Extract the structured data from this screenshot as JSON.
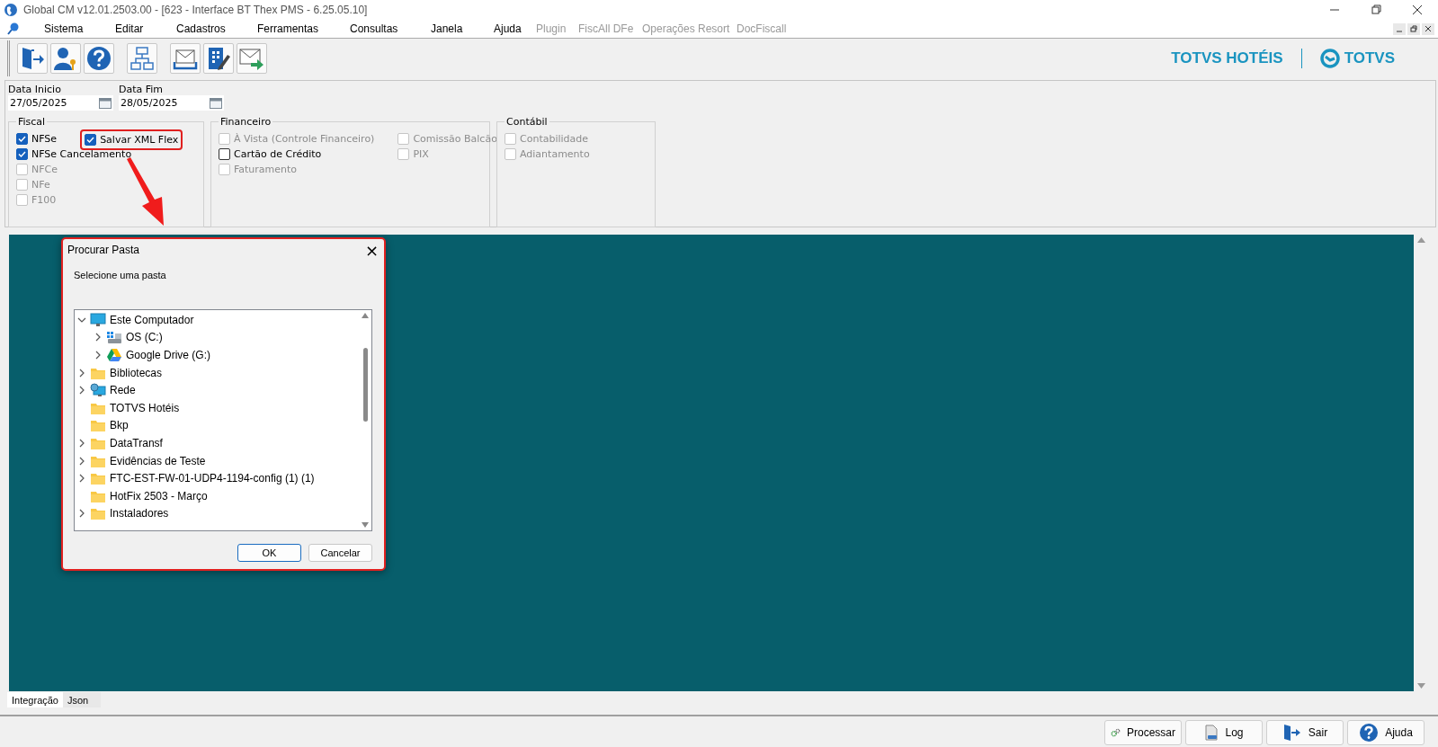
{
  "window": {
    "title": "Global CM v12.01.2503.00 - [623 - Interface BT Thex PMS - 6.25.05.10]"
  },
  "menu": [
    {
      "label": "Sistema",
      "disabled": false
    },
    {
      "label": "Editar",
      "disabled": false
    },
    {
      "label": "Cadastros",
      "disabled": false
    },
    {
      "label": "Ferramentas",
      "disabled": false
    },
    {
      "label": "Consultas",
      "disabled": false
    },
    {
      "label": "Janela",
      "disabled": false
    },
    {
      "label": "Ajuda",
      "disabled": false
    },
    {
      "label": "Plugin",
      "disabled": true
    },
    {
      "label": "FiscAll DFe",
      "disabled": true
    },
    {
      "label": "Operações Resort",
      "disabled": true
    },
    {
      "label": "DocFiscall",
      "disabled": true
    }
  ],
  "toolbar": [
    {
      "kind": "exit"
    },
    {
      "kind": "user"
    },
    {
      "kind": "help"
    },
    {
      "kind": "sep"
    },
    {
      "kind": "org"
    },
    {
      "kind": "sep"
    },
    {
      "kind": "mail"
    },
    {
      "kind": "grid"
    },
    {
      "kind": "send"
    }
  ],
  "brand": {
    "product": "TOTVS HOTÉIS",
    "logo": "TOTVS"
  },
  "dates": [
    {
      "label": "Data Inicio",
      "value": "27/05/2025"
    },
    {
      "label": "Data Fim",
      "value": "28/05/2025"
    }
  ],
  "groups": [
    {
      "title": "Fiscal",
      "columns": [
        [
          {
            "label": "NFSe",
            "checked": true,
            "disabled": false,
            "highlighted": false
          },
          {
            "label": "NFSe Cancelamento",
            "checked": true,
            "disabled": false,
            "highlighted": false
          },
          {
            "label": "NFCe",
            "checked": false,
            "disabled": true,
            "highlighted": false
          },
          {
            "label": "NFe",
            "checked": false,
            "disabled": true,
            "highlighted": false
          },
          {
            "label": "F100",
            "checked": false,
            "disabled": true,
            "highlighted": false
          }
        ],
        [
          {
            "label": "Salvar XML Flex",
            "checked": true,
            "disabled": false,
            "highlighted": true
          }
        ]
      ]
    },
    {
      "title": "Financeiro",
      "columns": [
        [
          {
            "label": "À Vista (Controle Financeiro)",
            "checked": false,
            "disabled": true,
            "highlighted": false
          },
          {
            "label": "Cartão de Crédito",
            "checked": false,
            "disabled": false,
            "highlighted": false
          },
          {
            "label": "Faturamento",
            "checked": false,
            "disabled": true,
            "highlighted": false
          }
        ],
        [
          {
            "label": "Comissão Balcão",
            "checked": false,
            "disabled": true,
            "highlighted": false
          },
          {
            "label": "PIX",
            "checked": false,
            "disabled": true,
            "highlighted": false
          }
        ]
      ]
    },
    {
      "title": "Contábil",
      "columns": [
        [
          {
            "label": "Contabilidade",
            "checked": false,
            "disabled": true,
            "highlighted": false
          },
          {
            "label": "Adiantamento",
            "checked": false,
            "disabled": true,
            "highlighted": false
          }
        ]
      ]
    }
  ],
  "dialog": {
    "title": "Procurar Pasta",
    "close": "×",
    "prompt": "Selecione uma pasta",
    "highlighted": true,
    "tree": [
      {
        "label": "Este Computador",
        "kind": "computer",
        "expandable": true,
        "expanded": true,
        "children": [
          {
            "label": "OS (C:)",
            "kind": "drive",
            "expandable": true,
            "expanded": false
          },
          {
            "label": "Google Drive (G:)",
            "kind": "cloud",
            "expandable": true,
            "expanded": false
          }
        ]
      },
      {
        "label": "Bibliotecas",
        "kind": "folder",
        "expandable": true,
        "expanded": false
      },
      {
        "label": "Rede",
        "kind": "network",
        "expandable": true,
        "expanded": false
      },
      {
        "label": "TOTVS Hotéis",
        "kind": "folder",
        "expandable": false
      },
      {
        "label": "Bkp",
        "kind": "folder",
        "expandable": false
      },
      {
        "label": "DataTransf",
        "kind": "folder",
        "expandable": true,
        "expanded": false
      },
      {
        "label": "Evidências de Teste",
        "kind": "folder",
        "expandable": true,
        "expanded": false
      },
      {
        "label": "FTC-EST-FW-01-UDP4-1194-config (1) (1)",
        "kind": "folder",
        "expandable": true,
        "expanded": false
      },
      {
        "label": "HotFix 2503 - Março",
        "kind": "folder",
        "expandable": false
      },
      {
        "label": "Instaladores",
        "kind": "folder",
        "expandable": true,
        "expanded": false
      }
    ],
    "buttons": [
      {
        "label": "OK",
        "default": true
      },
      {
        "label": "Cancelar",
        "default": false
      }
    ]
  },
  "tabs": [
    {
      "label": "Integração",
      "selected": true
    },
    {
      "label": "Json",
      "selected": false
    }
  ],
  "actions": [
    {
      "label": "Processar",
      "kind": "gears"
    },
    {
      "label": "Log",
      "kind": "log"
    },
    {
      "label": "Sair",
      "kind": "exit"
    },
    {
      "label": "Ajuda",
      "kind": "help"
    }
  ]
}
